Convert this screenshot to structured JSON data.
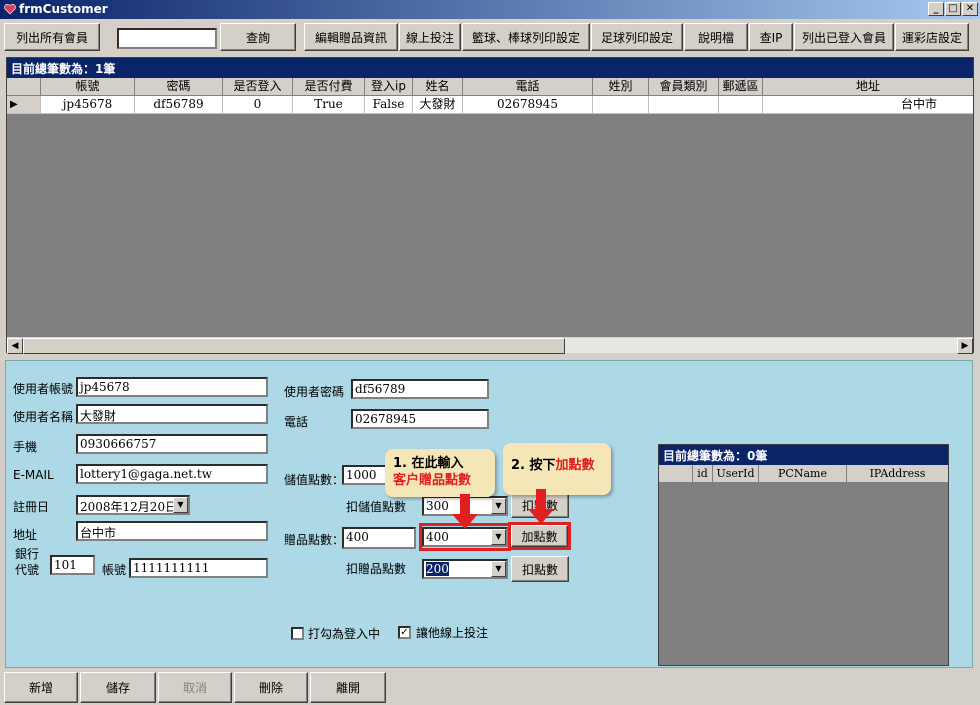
{
  "window": {
    "title": "frmCustomer",
    "min_btn": "_",
    "max_btn": "□",
    "close_btn": "✕"
  },
  "toolbar": {
    "list_all_members": "列出所有會員",
    "search_value": "",
    "query": "查詢",
    "edit_gift_info": "編輯贈品資訊",
    "online_bet": "線上投注",
    "basketball_print_settings": "籃球、棒球列印設定",
    "football_print_settings": "足球列印設定",
    "manual": "說明檔",
    "check_ip": "查IP",
    "list_logged_in": "列出已登入會員",
    "lottery_store_settings": "運彩店設定"
  },
  "member_grid": {
    "caption": "目前總筆數為：1筆",
    "columns": [
      "帳號",
      "密碼",
      "是否登入",
      "是否付費",
      "登入ip",
      "姓名",
      "電話",
      "姓別",
      "會員類別",
      "郵遞區",
      "地址"
    ],
    "rows": [
      [
        "jp45678",
        "df56789",
        "0",
        "True",
        "False",
        "大發財",
        "02678945",
        "",
        "",
        "",
        "台中市"
      ]
    ],
    "row_indicator": "▶",
    "scroll_left": "◀",
    "scroll_right": "▶"
  },
  "form": {
    "username_label": "使用者帳號",
    "username_value": "jp45678",
    "name_label": "使用者名稱",
    "name_value": "大發財",
    "mobile_label": "手機",
    "mobile_value": "0930666757",
    "email_label": "E-MAIL",
    "email_value": "lottery1@gaga.net.tw",
    "register_date_label": "註冊日",
    "register_date_value": "2008年12月20日",
    "address_label": "地址",
    "address_value": "台中市",
    "bank_code_label_line1": "銀行",
    "bank_code_label_line2": "代號",
    "bank_code_value": "101",
    "account_label": "帳號",
    "account_value": "1111111111",
    "password_label": "使用者密碼",
    "password_value": "df56789",
    "phone_label": "電話",
    "phone_value": "02678945",
    "stored_points_label": "儲值點數：",
    "stored_points_value": "1000",
    "deduct_stored_label": "扣儲值點數",
    "deduct_stored_value": "300",
    "deduct_stored_btn": "扣點數",
    "gift_points_label": "贈品點數：",
    "gift_points_value": "400",
    "gift_points_combo": "400",
    "add_points_btn": "加點數",
    "deduct_gift_label": "扣贈品點數",
    "deduct_gift_value": "200",
    "deduct_gift_btn": "扣點數",
    "mark_logged_in_label": "打勾為登入中",
    "mark_logged_in_checked": false,
    "allow_online_bet_label": "讓他線上投注",
    "allow_online_bet_checked": true,
    "check_mark": "✓"
  },
  "annotations": {
    "step1_line1": "1. 在此輸入",
    "step1_line2": "客户贈品點數",
    "step2_prefix": "2. 按下",
    "step2_highlight": "加點數"
  },
  "ip_grid": {
    "caption": "目前總筆數為：0筆",
    "columns": [
      "id",
      "UserId",
      "PCName",
      "IPAddress"
    ]
  },
  "bottom_buttons": {
    "add": "新增",
    "save": "儲存",
    "cancel": "取消",
    "delete": "刪除",
    "close": "離開"
  }
}
